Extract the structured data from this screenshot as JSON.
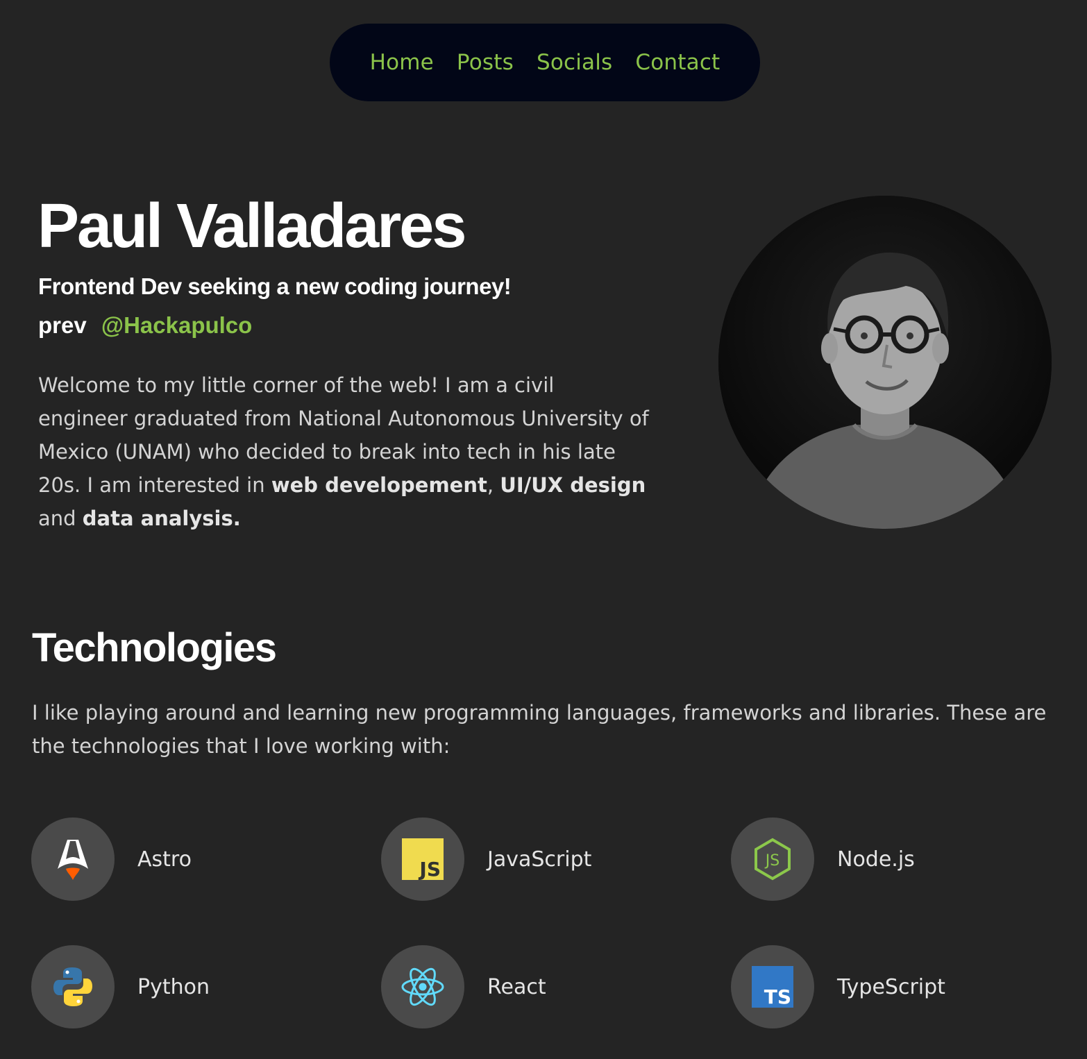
{
  "nav": {
    "items": [
      {
        "label": "Home"
      },
      {
        "label": "Posts"
      },
      {
        "label": "Socials"
      },
      {
        "label": "Contact"
      }
    ],
    "link_color": "#8bc34a",
    "background": "#020617"
  },
  "hero": {
    "name": "Paul Valladares",
    "tagline": "Frontend Dev seeking a new coding journey!",
    "prev_label": "prev",
    "prev_handle": "@Hackapulco",
    "bio": {
      "intro": "Welcome to my little corner of the web! I am a civil engineer graduated from National Autonomous University of Mexico (UNAM) who decided to break into tech in his late 20s. I am interested in ",
      "interest_1": "web developement",
      "sep_1": ", ",
      "interest_2": "UI/UX design",
      "sep_2": " and ",
      "interest_3": "data analysis."
    }
  },
  "technologies": {
    "title": "Technologies",
    "description": "I like playing around and learning new programming languages, frameworks and libraries. These are the technologies that I love working with:",
    "items": [
      {
        "label": "Astro",
        "icon": "astro-icon"
      },
      {
        "label": "JavaScript",
        "icon": "javascript-icon"
      },
      {
        "label": "Node.js",
        "icon": "nodejs-icon"
      },
      {
        "label": "Python",
        "icon": "python-icon"
      },
      {
        "label": "React",
        "icon": "react-icon"
      },
      {
        "label": "TypeScript",
        "icon": "typescript-icon"
      }
    ]
  },
  "colors": {
    "page_background": "#242424",
    "accent": "#8bc34a",
    "icon_circle": "#4a4a4a"
  }
}
